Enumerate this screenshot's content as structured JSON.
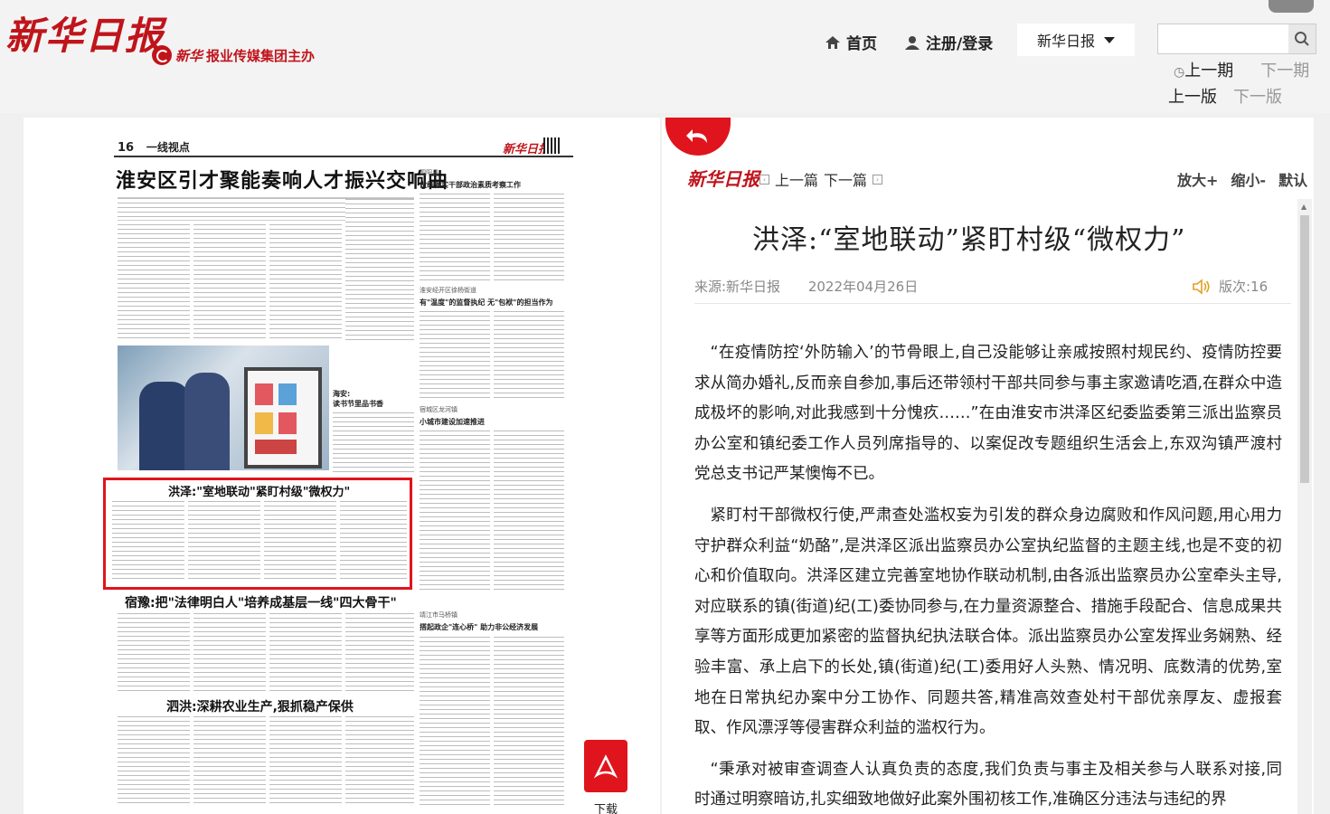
{
  "site": {
    "logo": "新华日报",
    "subtitle": "报业传媒集团主办",
    "subtitle_prefix": "新华"
  },
  "nav": {
    "home": "首页",
    "login": "注册/登录",
    "paper_select": "新华日报",
    "search_placeholder": "",
    "prev_issue": "上一期",
    "next_issue": "下一期",
    "prev_page": "上一版",
    "next_page": "下一版"
  },
  "newspaper": {
    "page_number": "16",
    "section": "一线视点",
    "logo": "新华日报",
    "main_headline": "淮安区引才聚能奏响人才振兴交响曲",
    "photo_caption": "海安:\n读书节里品书香",
    "side_heads": [
      "泗阳县",
      "做细做实干部政治素质考察工作",
      "淮安经开区徐杨街道",
      "有\"温度\"的监督执纪 无\"包袱\"的担当作为",
      "宿城区龙河镇",
      "小城市建设加速推进",
      "靖江市马桥镇",
      "搭起政企\"连心桥\" 助力非公经济发展"
    ],
    "highlight_headline": "洪泽:\"室地联动\"紧盯村级\"微权力\"",
    "headline2": "宿豫:把\"法律明白人\"培养成基层一线\"四大骨干\"",
    "headline3": "泗洪:深耕农业生产,狠抓稳产保供",
    "download": "下载"
  },
  "article": {
    "logo": "新华日报",
    "prev_article": "上一篇",
    "next_article": "下一篇",
    "zoom_in": "放大+",
    "zoom_out": "缩小-",
    "zoom_default": "默认",
    "title": "洪泽:“室地联动”紧盯村级“微权力”",
    "source": "来源:新华日报",
    "date": "2022年04月26日",
    "edition": "版次:16",
    "paragraphs": [
      "“在疫情防控‘外防输入’的节骨眼上,自己没能够让亲戚按照村规民约、疫情防控要求从简办婚礼,反而亲自参加,事后还带领村干部共同参与事主家邀请吃酒,在群众中造成极坏的影响,对此我感到十分愧疚……”在由淮安市洪泽区纪委监委第三派出监察员办公室和镇纪委工作人员列席指导的、以案促改专题组织生活会上,东双沟镇严渡村党总支书记严某懊悔不已。",
      "紧盯村干部微权行使,严肃查处滥权妄为引发的群众身边腐败和作风问题,用心用力守护群众利益“奶酪”,是洪泽区派出监察员办公室执纪监督的主题主线,也是不变的初心和价值取向。洪泽区建立完善室地协作联动机制,由各派出监察员办公室牵头主导,对应联系的镇(街道)纪(工)委协同参与,在力量资源整合、措施手段配合、信息成果共享等方面形成更加紧密的监督执纪执法联合体。派出监察员办公室发挥业务娴熟、经验丰富、承上启下的长处,镇(街道)纪(工)委用好人头熟、情况明、底数清的优势,室地在日常执纪办案中分工协作、同题共答,精准高效查处村干部优亲厚友、虚报套取、作风漂浮等侵害群众利益的滥权行为。",
      "“秉承对被审查调查人认真负责的态度,我们负责与事主及相关参与人联系对接,同时通过明察暗访,扎实细致地做好此案外围初核工作,准确区分违法与违纪的界"
    ]
  },
  "colors": {
    "brand_red": "#c0141b",
    "highlight_red": "#e0141d"
  }
}
